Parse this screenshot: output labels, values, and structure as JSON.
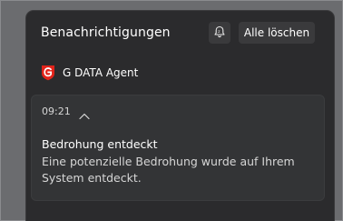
{
  "header": {
    "title": "Benachrichtigungen",
    "snooze_icon": "bell-snooze-icon",
    "clear_all_label": "Alle löschen"
  },
  "app": {
    "name": "G DATA Agent",
    "logo_icon": "gdata-logo-icon",
    "brand_color": "#e2231a"
  },
  "notification": {
    "time": "09:21",
    "collapse_icon": "chevron-up-icon",
    "title": "Bedrohung entdeckt",
    "body": "Eine potenzielle Bedrohung wurde auf Ihrem System entdeckt."
  }
}
